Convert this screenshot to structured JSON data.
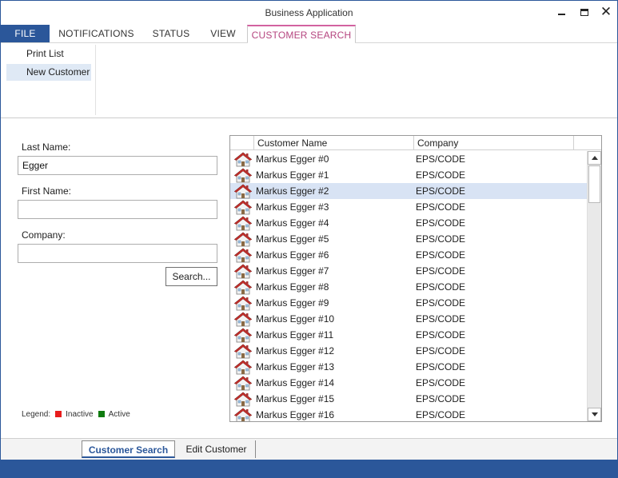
{
  "window": {
    "title": "Business Application"
  },
  "titlebar": {
    "minimize_icon": "minimize-icon",
    "maximize_icon": "maximize-icon",
    "close_icon": "close-icon"
  },
  "ribbon_tabs": [
    "FILE",
    "NOTIFICATIONS",
    "STATUS",
    "VIEW",
    "CUSTOMER SEARCH"
  ],
  "ribbon_active_tab": "CUSTOMER SEARCH",
  "ribbon_items": [
    "Print List",
    "New Customer"
  ],
  "form": {
    "last_name_label": "Last Name:",
    "last_name_value": "Egger",
    "first_name_label": "First Name:",
    "first_name_value": "",
    "company_label": "Company:",
    "company_value": "",
    "search_button": "Search..."
  },
  "legend": {
    "label": "Legend:",
    "inactive": "Inactive",
    "active": "Active",
    "inactive_color": "#e81c1c",
    "active_color": "#0f7b0f"
  },
  "grid": {
    "headers": [
      "Customer Name",
      "Company"
    ],
    "selected_row": 2,
    "rows": [
      {
        "name": "Markus Egger #0",
        "company": "EPS/CODE"
      },
      {
        "name": "Markus Egger #1",
        "company": "EPS/CODE"
      },
      {
        "name": "Markus Egger #2",
        "company": "EPS/CODE"
      },
      {
        "name": "Markus Egger #3",
        "company": "EPS/CODE"
      },
      {
        "name": "Markus Egger #4",
        "company": "EPS/CODE"
      },
      {
        "name": "Markus Egger #5",
        "company": "EPS/CODE"
      },
      {
        "name": "Markus Egger #6",
        "company": "EPS/CODE"
      },
      {
        "name": "Markus Egger #7",
        "company": "EPS/CODE"
      },
      {
        "name": "Markus Egger #8",
        "company": "EPS/CODE"
      },
      {
        "name": "Markus Egger #9",
        "company": "EPS/CODE"
      },
      {
        "name": "Markus Egger #10",
        "company": "EPS/CODE"
      },
      {
        "name": "Markus Egger #11",
        "company": "EPS/CODE"
      },
      {
        "name": "Markus Egger #12",
        "company": "EPS/CODE"
      },
      {
        "name": "Markus Egger #13",
        "company": "EPS/CODE"
      },
      {
        "name": "Markus Egger #14",
        "company": "EPS/CODE"
      },
      {
        "name": "Markus Egger #15",
        "company": "EPS/CODE"
      },
      {
        "name": "Markus Egger #16",
        "company": "EPS/CODE"
      }
    ]
  },
  "bottom_tabs": [
    "Customer Search",
    "Edit Customer"
  ],
  "bottom_active_tab": "Customer Search",
  "colors": {
    "accent": "#2b579a",
    "contextual_tab": "#b5457f",
    "selected_row": "#d8e3f4"
  }
}
